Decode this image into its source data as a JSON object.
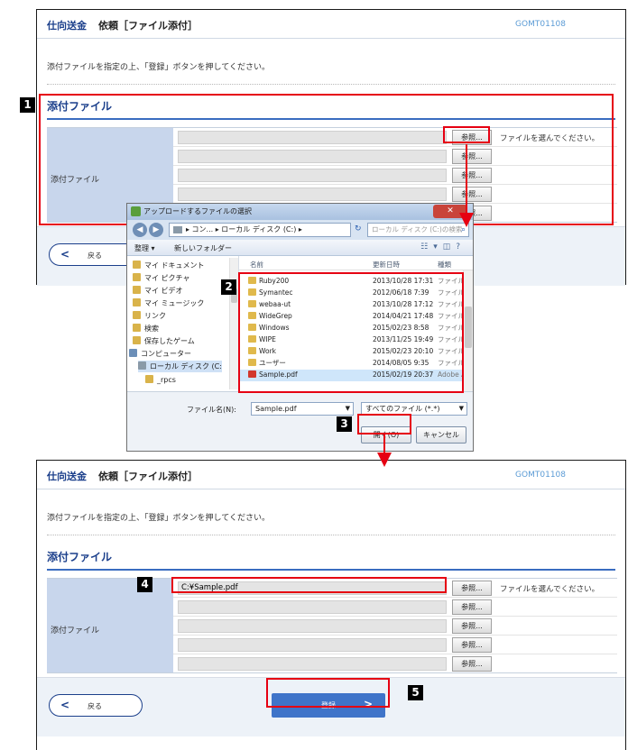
{
  "panel": {
    "title": "仕向送金",
    "subtitle": "依頼［ファイル添付］",
    "code": "GOMT01108",
    "instruction": "添付ファイルを指定の上、「登録」ボタンを押してください。",
    "section_title": "添付ファイル",
    "field_label": "添付ファイル",
    "browse_label": "参照...",
    "note": "ファイルを選んでください。",
    "back_label": "戻る",
    "register_label": "登録"
  },
  "panel2_file_value": "C:¥Sample.pdf",
  "dialog": {
    "title": "アップロードするファイルの選択",
    "address": "▸ コン... ▸ ローカル ディスク (C:) ▸",
    "search_placeholder": "ローカル ディスク (C:)の検索",
    "organize": "整理 ▾",
    "new_folder": "新しいフォルダー",
    "nav_items": [
      "マイ ドキュメント",
      "マイ ピクチャ",
      "マイ ビデオ",
      "マイ ミュージック",
      "リンク",
      "検索",
      "保存したゲーム",
      "コンピューター",
      "ローカル ディスク (C:",
      "_rpcs"
    ],
    "columns": [
      "名前",
      "更新日時",
      "種類"
    ],
    "files": [
      {
        "name": "Ruby200",
        "date": "2013/10/28 17:31",
        "type": "ファイル"
      },
      {
        "name": "Symantec",
        "date": "2012/06/18 7:39",
        "type": "ファイル"
      },
      {
        "name": "webaa-ut",
        "date": "2013/10/28 17:12",
        "type": "ファイル"
      },
      {
        "name": "WideGrep",
        "date": "2014/04/21 17:48",
        "type": "ファイル"
      },
      {
        "name": "Windows",
        "date": "2015/02/23 8:58",
        "type": "ファイル"
      },
      {
        "name": "WIPE",
        "date": "2013/11/25 19:49",
        "type": "ファイル"
      },
      {
        "name": "Work",
        "date": "2015/02/23 20:10",
        "type": "ファイル"
      },
      {
        "name": "ユーザー",
        "date": "2014/08/05 9:35",
        "type": "ファイル"
      },
      {
        "name": "Sample.pdf",
        "date": "2015/02/19 20:37",
        "type": "Adobe A"
      }
    ],
    "filename_label": "ファイル名(N):",
    "filename_value": "Sample.pdf",
    "filetype": "すべてのファイル (*.*)",
    "open_label": "開く(O)",
    "cancel_label": "キャンセル"
  },
  "steps": [
    "1",
    "2",
    "3",
    "4",
    "5"
  ],
  "colors": {
    "highlight": "#e60012",
    "title": "#1b3f8b",
    "label_bg": "#c8d6ec",
    "register": "#3f74c9"
  },
  "icons": [
    "chevron-left-icon",
    "chevron-right-icon",
    "folder-icon",
    "pdf-icon",
    "search-icon",
    "refresh-icon"
  ]
}
